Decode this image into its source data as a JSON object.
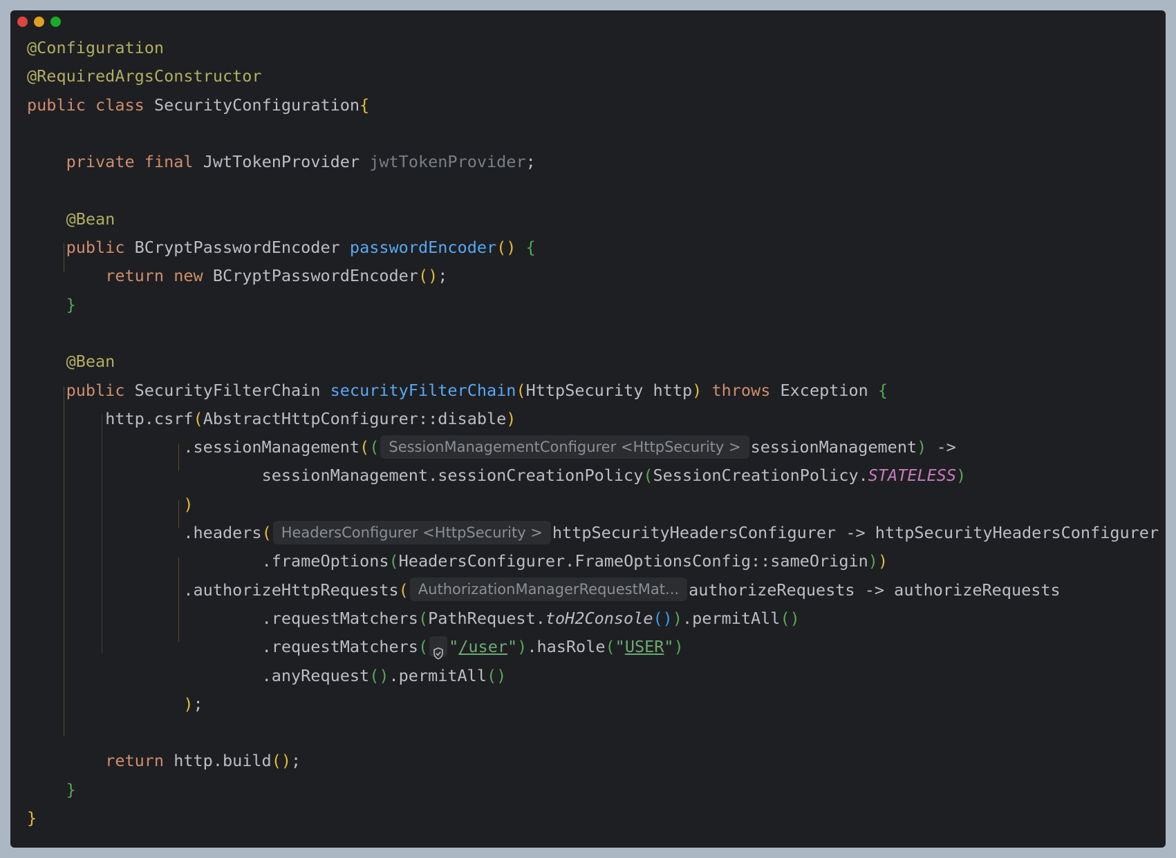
{
  "window": {
    "controls": [
      "close",
      "minimize",
      "maximize"
    ]
  },
  "code": {
    "l1": {
      "ann": "@Configuration"
    },
    "l2": {
      "ann": "@RequiredArgsConstructor"
    },
    "l3": {
      "kw1": "public",
      "kw2": "class",
      "name": "SecurityConfiguration",
      "brace": "{"
    },
    "l5": {
      "kw1": "private",
      "kw2": "final",
      "type": "JwtTokenProvider",
      "field": "jwtTokenProvider",
      "semi": ";"
    },
    "l7": {
      "ann": "@Bean"
    },
    "l8": {
      "kw": "public",
      "type": "BCryptPasswordEncoder",
      "fn": "passwordEncoder",
      "parens": "()",
      "brace": "{"
    },
    "l9": {
      "kw1": "return",
      "kw2": "new",
      "type": "BCryptPasswordEncoder",
      "parens": "()",
      "semi": ";"
    },
    "l10": {
      "brace": "}"
    },
    "l12": {
      "ann": "@Bean"
    },
    "l13": {
      "kw": "public",
      "type": "SecurityFilterChain",
      "fn": "securityFilterChain",
      "open": "(",
      "args": "HttpSecurity http",
      "close": ")",
      "throws": "throws",
      "exc": "Exception",
      "brace": "{"
    },
    "l14": {
      "a": "http.csrf",
      "open": "(",
      "arg": "AbstractHttpConfigurer::disable",
      "close": ")"
    },
    "l15": {
      "a": ".sessionManagement",
      "open1": "(",
      "open2": "(",
      "hint": "SessionManagementConfigurer <HttpSecurity >",
      "b": "sessionManagement",
      "close": ")",
      "arrow": " ->"
    },
    "l16": {
      "a": "sessionManagement.sessionCreationPolicy",
      "open": "(",
      "b": "SessionCreationPolicy.",
      "const": "STATELESS",
      "close": ")"
    },
    "l17": {
      "close": ")"
    },
    "l18": {
      "a": ".headers",
      "open": "(",
      "hint": "HeadersConfigurer <HttpSecurity >",
      "b": "httpSecurityHeadersConfigurer -> httpSecurityHeadersConfigurer"
    },
    "l19": {
      "a": ".frameOptions",
      "open": "(",
      "b": "HeadersConfigurer.FrameOptionsConfig::sameOrigin",
      "close1": ")",
      "close2": ")"
    },
    "l20": {
      "a": ".authorizeHttpRequests",
      "open": "(",
      "hint": "AuthorizationManagerRequestMat...",
      "b": "authorizeRequests -> authorizeRequests"
    },
    "l21": {
      "a": ".requestMatchers",
      "open": "(",
      "b": "PathRequest.",
      "static": "toH2Console",
      "parens": "()",
      "close": ")",
      "c": ".permitAll",
      "parens2": "()"
    },
    "l22": {
      "a": ".requestMatchers",
      "open": "(",
      "q1": "\"",
      "path": "/user",
      "q2": "\"",
      "close": ")",
      "c": ".hasRole",
      "open2": "(",
      "q3": "\"",
      "role": "USER",
      "q4": "\"",
      "close2": ")"
    },
    "l23": {
      "a": ".anyRequest",
      "parens": "()",
      "b": ".permitAll",
      "parens2": "()"
    },
    "l24": {
      "close": ")",
      "semi": ";"
    },
    "l26": {
      "kw": "return",
      "a": " http.build",
      "parens": "()",
      "semi": ";"
    },
    "l27": {
      "brace": "}"
    },
    "l28": {
      "brace": "}"
    }
  },
  "colors": {
    "background": "#1e1f22",
    "keyword": "#cf8e6d",
    "annotation": "#b3ae60",
    "function": "#56a8f5",
    "string": "#6aab73",
    "constant": "#c77dbb",
    "text": "#bcbec4"
  },
  "icons": {
    "security_icon": "shield-check-icon"
  }
}
